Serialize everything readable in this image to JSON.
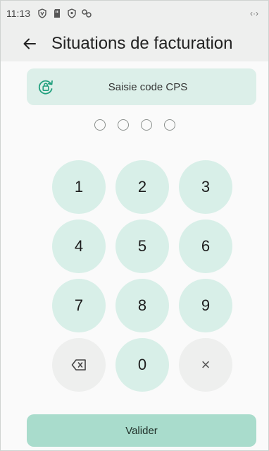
{
  "status_bar": {
    "time": "11:13",
    "icons": [
      "shield-v-icon",
      "sd-card-icon",
      "security-shield-icon",
      "link-icon"
    ],
    "right_icon": "sync-arrows-icon",
    "right_glyph": "‹·›"
  },
  "app_bar": {
    "title": "Situations de facturation",
    "back_icon": "back-arrow-icon"
  },
  "cps": {
    "label": "Saisie code CPS",
    "icon": "lock-cycle-icon"
  },
  "pin": {
    "length": 4,
    "entered": 0
  },
  "keypad": {
    "keys": [
      "1",
      "2",
      "3",
      "4",
      "5",
      "6",
      "7",
      "8",
      "9"
    ],
    "zero": "0",
    "backspace_icon": "backspace-icon",
    "clear_label": "×"
  },
  "actions": {
    "validate_label": "Valider"
  },
  "colors": {
    "key_bg": "#d8efe8",
    "alt_key_bg": "#eeefee",
    "card_bg": "#dcefe9",
    "button_bg": "#a9dccc",
    "accent": "#21a07e"
  }
}
